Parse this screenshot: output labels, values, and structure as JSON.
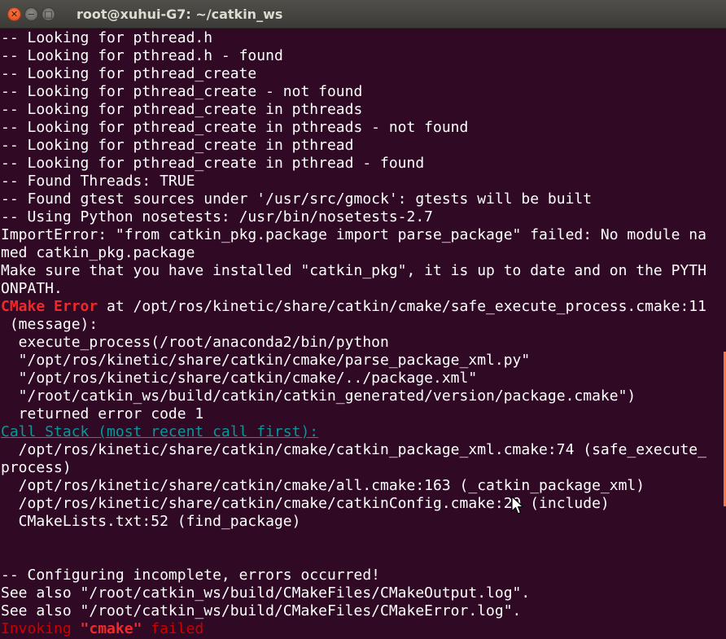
{
  "window": {
    "title": "root@xuhui-G7: ~/catkin_ws",
    "close_glyph": "✕",
    "minimize_glyph": "−",
    "maximize_glyph": "□"
  },
  "terminal": {
    "lines": [
      "-- Looking for pthread.h",
      "-- Looking for pthread.h - found",
      "-- Looking for pthread_create",
      "-- Looking for pthread_create - not found",
      "-- Looking for pthread_create in pthreads",
      "-- Looking for pthread_create in pthreads - not found",
      "-- Looking for pthread_create in pthread",
      "-- Looking for pthread_create in pthread - found",
      "-- Found Threads: TRUE",
      "-- Found gtest sources under '/usr/src/gmock': gtests will be built",
      "-- Using Python nosetests: /usr/bin/nosetests-2.7",
      "ImportError: \"from catkin_pkg.package import parse_package\" failed: No module na",
      "med catkin_pkg.package",
      "Make sure that you have installed \"catkin_pkg\", it is up to date and on the PYTH",
      "ONPATH."
    ],
    "cmake_error_label": "CMake Error",
    "cmake_error_rest": " at /opt/ros/kinetic/share/catkin/cmake/safe_execute_process.cmake:11",
    "lines2": [
      " (message):",
      "  execute_process(/root/anaconda2/bin/python",
      "  \"/opt/ros/kinetic/share/catkin/cmake/parse_package_xml.py\"",
      "  \"/opt/ros/kinetic/share/catkin/cmake/../package.xml\"",
      "  \"/root/catkin_ws/build/catkin/catkin_generated/version/package.cmake\")",
      "  returned error code 1"
    ],
    "call_stack_label": "Call Stack (most recent call first):",
    "lines3": [
      "  /opt/ros/kinetic/share/catkin/cmake/catkin_package_xml.cmake:74 (safe_execute_",
      "process)",
      "  /opt/ros/kinetic/share/catkin/cmake/all.cmake:163 (_catkin_package_xml)",
      "  /opt/ros/kinetic/share/catkin/cmake/catkinConfig.cmake:20 (include)",
      "  CMakeLists.txt:52 (find_package)",
      "",
      "",
      "-- Configuring incomplete, errors occurred!",
      "See also \"/root/catkin_ws/build/CMakeFiles/CMakeOutput.log\".",
      "See also \"/root/catkin_ws/build/CMakeFiles/CMakeError.log\"."
    ],
    "invoking_prefix": "Invoking ",
    "invoking_cmd": "\"cmake\"",
    "invoking_suffix": " failed"
  },
  "colors": {
    "background": "#300a24",
    "error_red": "#ef2929",
    "link_teal": "#06989a",
    "scrollbar_orange": "#f07746"
  }
}
